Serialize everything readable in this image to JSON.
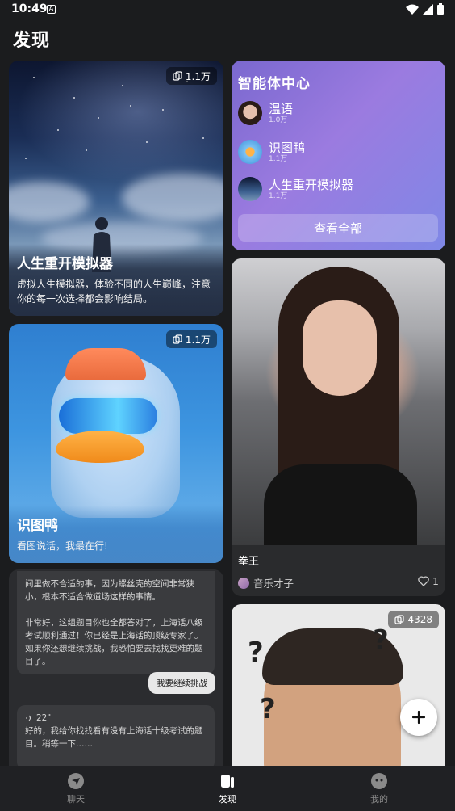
{
  "status_bar": {
    "time": "10:49"
  },
  "page_title": "发现",
  "card_life_sim": {
    "count": "1.1万",
    "title": "人生重开模拟器",
    "desc": "虚拟人生模拟器，体验不同的人生巅峰，注意你的每一次选择都会影响结局。"
  },
  "card_duck": {
    "count": "1.1万",
    "title": "识图鸭",
    "desc": "看图说话，我最在行!"
  },
  "chat_card": {
    "ai_text_1": "间里做不合适的事，因为螺丝壳的空间非常狭小，根本不适合做道场这样的事情。",
    "ai_text_2": "非常好，这组题目你也全都答对了，上海话八级考试顺利通过！你已经是上海话的顶级专家了。如果你还想继续挑战，我恐怕要去找找更难的题目了。",
    "user_text": "我要继续挑战",
    "voice_duration": "22\"",
    "ai_text_3": "好的，我给你找找看有没有上海话十级考试的题目。稍等一下……"
  },
  "agent_hub": {
    "title": "智能体中心",
    "items": [
      {
        "name": "温语",
        "count": "1.0万"
      },
      {
        "name": "识图鸭",
        "count": "1.1万"
      },
      {
        "name": "人生重开模拟器",
        "count": "1.1万"
      }
    ],
    "view_all": "查看全部"
  },
  "boxer_card": {
    "name": "拳王",
    "author": "音乐才子",
    "likes": "1"
  },
  "meme_card": {
    "count": "4328"
  },
  "bottom_nav": [
    {
      "label": "聊天"
    },
    {
      "label": "发现"
    },
    {
      "label": "我的"
    }
  ]
}
